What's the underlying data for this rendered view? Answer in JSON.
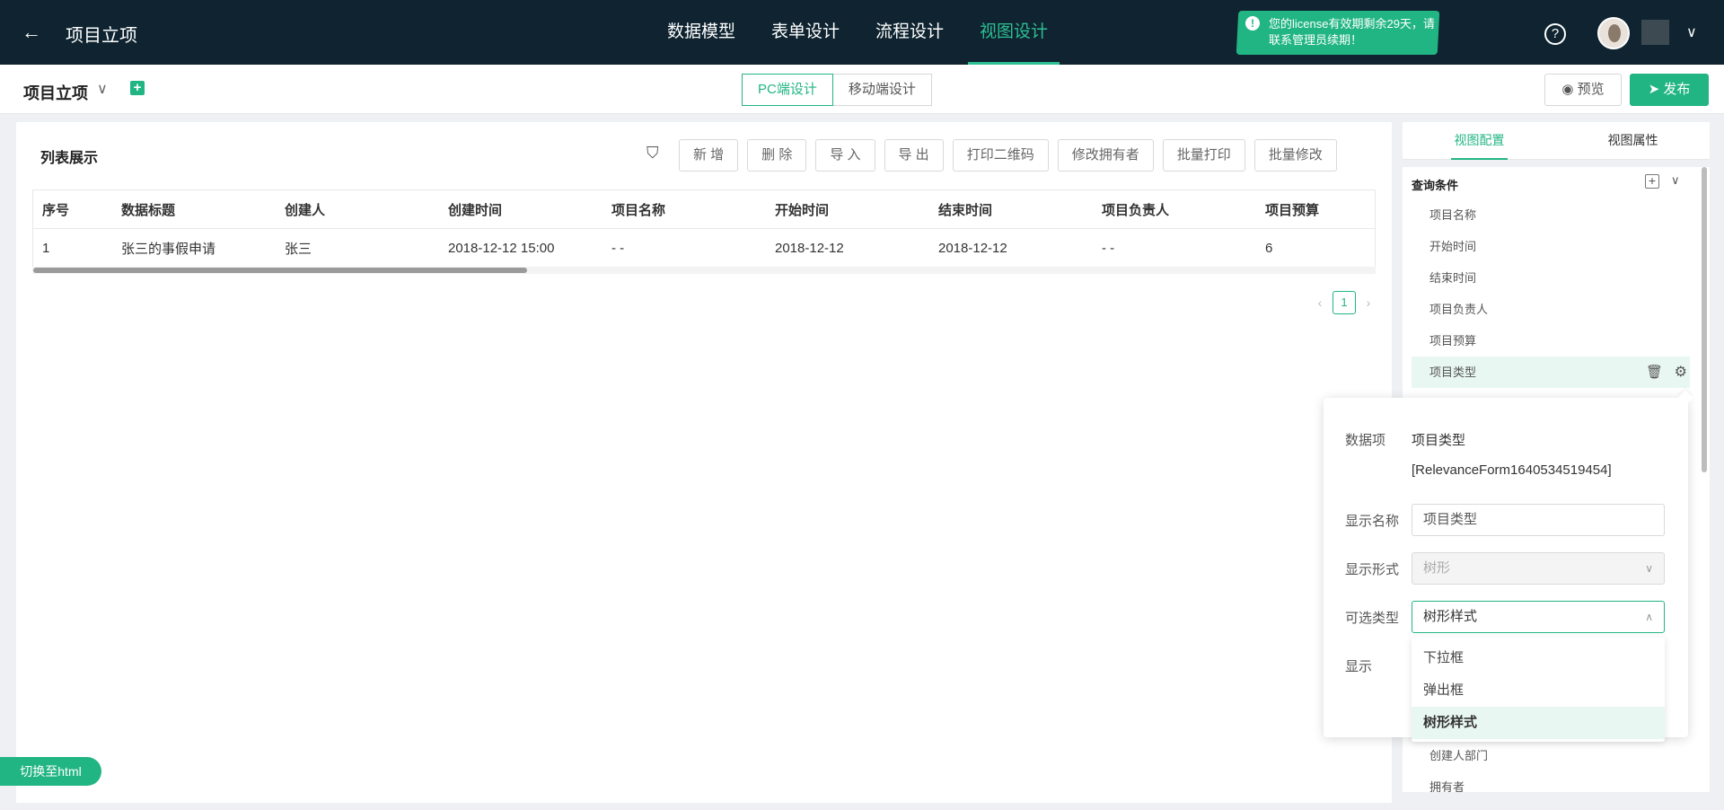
{
  "topbar": {
    "back_glyph": "←",
    "app_title": "项目立项",
    "nav_tabs": [
      {
        "label": "数据模型"
      },
      {
        "label": "表单设计"
      },
      {
        "label": "流程设计"
      },
      {
        "label": "视图设计"
      }
    ],
    "license_notice": "您的license有效期剩余29天，请联系管理员续期！",
    "help_glyph": "?",
    "user_chevron": "∨"
  },
  "subbar": {
    "form_title": "项目立项",
    "form_chevron": "∨",
    "add_glyph": "+",
    "design_modes": [
      {
        "label": "PC端设计"
      },
      {
        "label": "移动端设计"
      }
    ],
    "preview_label": "预览",
    "publish_label": "发布"
  },
  "list": {
    "title": "列表展示",
    "filter_glyph": "⛉",
    "toolbar": [
      {
        "label": "新 增"
      },
      {
        "label": "删 除"
      },
      {
        "label": "导 入"
      },
      {
        "label": "导 出"
      },
      {
        "label": "打印二维码"
      },
      {
        "label": "修改拥有者"
      },
      {
        "label": "批量打印"
      },
      {
        "label": "批量修改"
      }
    ],
    "columns": [
      "序号",
      "数据标题",
      "创建人",
      "创建时间",
      "项目名称",
      "开始时间",
      "结束时间",
      "项目负责人",
      "项目预算"
    ],
    "rows": [
      [
        "1",
        "张三的事假申请",
        "张三",
        "2018-12-12 15:00",
        "- -",
        "2018-12-12",
        "2018-12-12",
        "- -",
        "6"
      ]
    ],
    "pager": {
      "prev": "‹",
      "current": "1",
      "next": "›"
    },
    "switch_label": "切换至html"
  },
  "right_panel": {
    "tabs": [
      {
        "label": "视图配置"
      },
      {
        "label": "视图属性"
      }
    ],
    "section_title": "查询条件",
    "add_glyph": "+",
    "collapse_glyph": "∨",
    "conditions": [
      "项目名称",
      "开始时间",
      "结束时间",
      "项目负责人",
      "项目预算",
      "项目类型"
    ],
    "more_conditions": [
      "创建人部门",
      "拥有者"
    ],
    "trash_glyph": "🗑",
    "gear_glyph": "⚙"
  },
  "popover": {
    "data_item_label": "数据项",
    "data_item_name": "项目类型",
    "data_item_code": "[RelevanceForm1640534519454]",
    "display_name_label": "显示名称",
    "display_name_value": "项目类型",
    "display_form_label": "显示形式",
    "display_form_value": "树形",
    "selectable_type_label": "可选类型",
    "selectable_type_value": "树形样式",
    "show_label": "显示",
    "chev_down": "∨",
    "chev_up": "∧",
    "options": [
      {
        "label": "下拉框"
      },
      {
        "label": "弹出框"
      },
      {
        "label": "树形样式"
      }
    ]
  },
  "colors": {
    "accent": "#22b584",
    "topbar_bg": "#0f2430",
    "active_nav": "#2dbf94"
  }
}
